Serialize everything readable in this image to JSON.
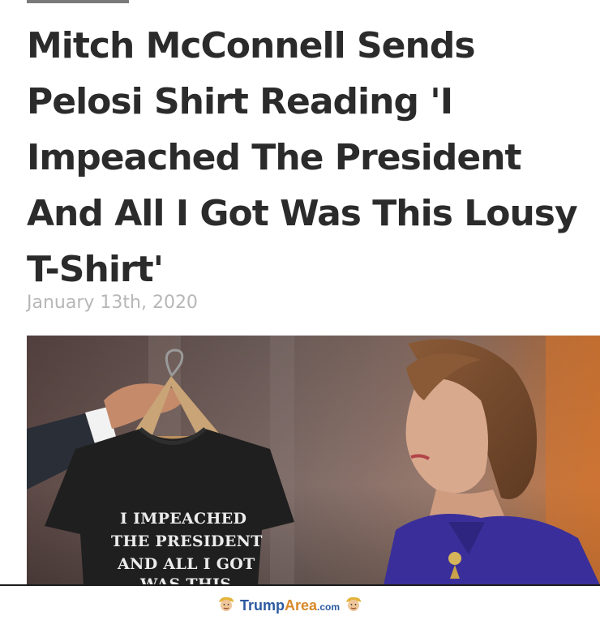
{
  "article": {
    "headline": "Mitch McConnell Sends Pelosi Shirt Reading 'I Impeached The President And All I Got Was This Lousy T-Shirt'",
    "date": "January 13th, 2020"
  },
  "photo": {
    "shirt_lines": [
      "I IMPEACHED",
      "THE PRESIDENT",
      "AND ALL I GOT",
      "WAS THIS"
    ]
  },
  "footer": {
    "brand_primary": "Trump",
    "brand_accent": "Area",
    "brand_tld": ".com"
  },
  "colors": {
    "headline": "#2b2b2b",
    "date": "#b7b7b7",
    "brand_blue": "#2c5aa0",
    "brand_orange": "#d8892a"
  },
  "icons": [
    "trump-face-icon",
    "trump-face-icon"
  ]
}
